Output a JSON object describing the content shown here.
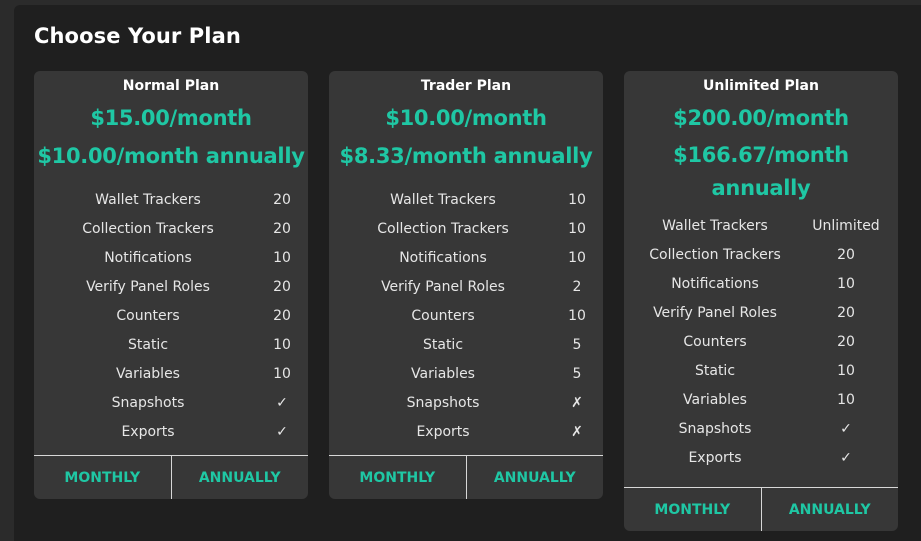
{
  "page": {
    "title": "Choose Your Plan"
  },
  "colors": {
    "accent": "#1fc7a4",
    "card_bg": "#373737",
    "panel_bg": "#1f1f1f"
  },
  "plans": [
    {
      "name": "Normal Plan",
      "price_monthly": "$15.00/month",
      "price_annual": "$10.00/month annually",
      "features": [
        {
          "name": "Wallet Trackers",
          "value": "20"
        },
        {
          "name": "Collection Trackers",
          "value": "20"
        },
        {
          "name": "Notifications",
          "value": "10"
        },
        {
          "name": "Verify Panel Roles",
          "value": "20"
        },
        {
          "name": "Counters",
          "value": "20"
        },
        {
          "name": "Static",
          "value": "10"
        },
        {
          "name": "Variables",
          "value": "10"
        },
        {
          "name": "Snapshots",
          "value": "✓"
        },
        {
          "name": "Exports",
          "value": "✓"
        }
      ],
      "buttons": {
        "monthly": "MONTHLY",
        "annually": "ANNUALLY"
      }
    },
    {
      "name": "Trader Plan",
      "price_monthly": "$10.00/month",
      "price_annual": "$8.33/month annually",
      "features": [
        {
          "name": "Wallet Trackers",
          "value": "10"
        },
        {
          "name": "Collection Trackers",
          "value": "10"
        },
        {
          "name": "Notifications",
          "value": "10"
        },
        {
          "name": "Verify Panel Roles",
          "value": "2"
        },
        {
          "name": "Counters",
          "value": "10"
        },
        {
          "name": "Static",
          "value": "5"
        },
        {
          "name": "Variables",
          "value": "5"
        },
        {
          "name": "Snapshots",
          "value": "✗"
        },
        {
          "name": "Exports",
          "value": "✗"
        }
      ],
      "buttons": {
        "monthly": "MONTHLY",
        "annually": "ANNUALLY"
      }
    },
    {
      "name": "Unlimited Plan",
      "price_monthly": "$200.00/month",
      "price_annual": "$166.67/month annually",
      "features": [
        {
          "name": "Wallet Trackers",
          "value": "Unlimited"
        },
        {
          "name": "Collection Trackers",
          "value": "20"
        },
        {
          "name": "Notifications",
          "value": "10"
        },
        {
          "name": "Verify Panel Roles",
          "value": "20"
        },
        {
          "name": "Counters",
          "value": "20"
        },
        {
          "name": "Static",
          "value": "10"
        },
        {
          "name": "Variables",
          "value": "10"
        },
        {
          "name": "Snapshots",
          "value": "✓"
        },
        {
          "name": "Exports",
          "value": "✓"
        }
      ],
      "buttons": {
        "monthly": "MONTHLY",
        "annually": "ANNUALLY"
      }
    }
  ]
}
